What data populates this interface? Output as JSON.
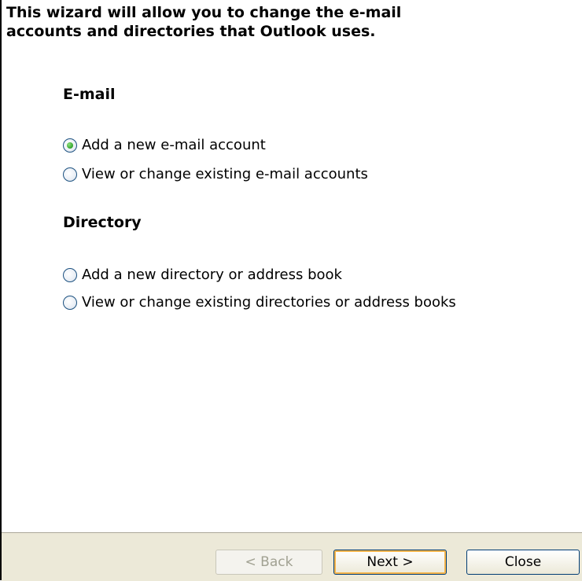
{
  "intro": "This wizard will allow you to change the e-mail\naccounts and directories that Outlook uses.",
  "email_section": {
    "heading": "E-mail",
    "options": [
      {
        "label": "Add a new e-mail account",
        "selected": true
      },
      {
        "label": "View or change existing e-mail accounts",
        "selected": false
      }
    ]
  },
  "directory_section": {
    "heading": "Directory",
    "options": [
      {
        "label": "Add a new directory or address book",
        "selected": false
      },
      {
        "label": "View or change existing directories or address books",
        "selected": false
      }
    ]
  },
  "buttons": {
    "back": "< Back",
    "next": "Next >",
    "close": "Close"
  },
  "colors": {
    "footer_bg": "#ece9d8",
    "radio_border": "#1c5180",
    "radio_dot": "#2fa32a",
    "default_button_highlight": "#f6b54b"
  }
}
